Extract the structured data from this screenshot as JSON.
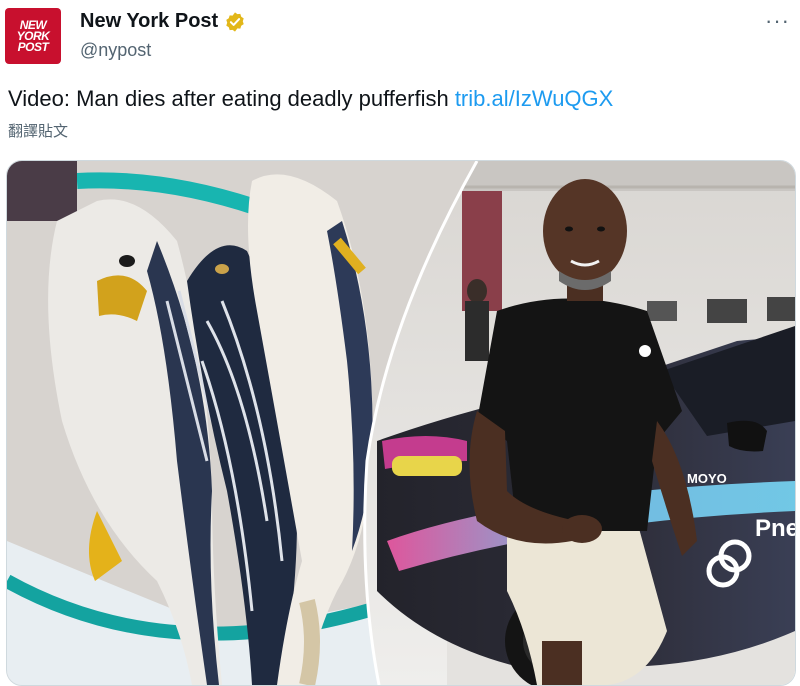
{
  "tweet": {
    "author_name": "New York Post",
    "author_handle": "@nypost",
    "avatar_text": [
      "NEW",
      "YORK",
      "POST"
    ],
    "more_label": "···",
    "text": "Video: Man dies after eating deadly pufferfish ",
    "link_text": "trib.al/IzWuQGX",
    "translate_label": "翻譯貼文",
    "car_branding": [
      "Pne",
      "MOYO"
    ]
  },
  "colors": {
    "brand_red": "#c8102e",
    "link_blue": "#1d9bf0",
    "verified_gold": "#e2b719"
  }
}
